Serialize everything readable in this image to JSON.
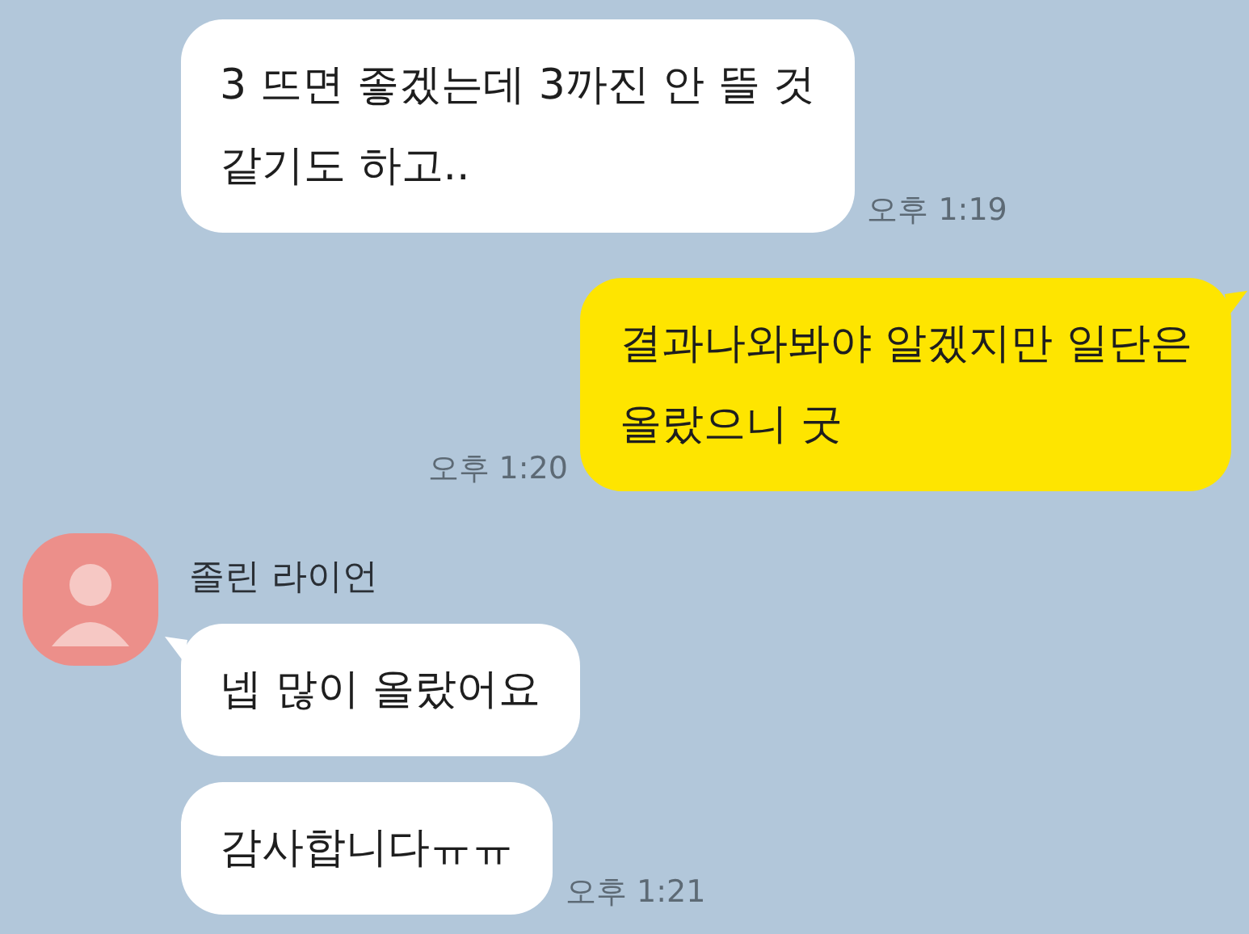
{
  "messages": [
    {
      "kind": "received",
      "tail": false,
      "text": "3 뜨면 좋겠는데 3까진 안 뜰 것\n같기도 하고..",
      "time": "오후 1:19"
    },
    {
      "kind": "sent",
      "tail": true,
      "text": "결과나와봐야 알겠지만 일단은\n올랐으니 굿",
      "time": "오후 1:20"
    },
    {
      "kind": "sender",
      "name": "졸린 라이언"
    },
    {
      "kind": "received",
      "tail": true,
      "text": "넵 많이 올랐어요"
    },
    {
      "kind": "received",
      "tail": false,
      "text": "감사합니다ㅠㅠ",
      "time": "오후 1:21"
    }
  ]
}
